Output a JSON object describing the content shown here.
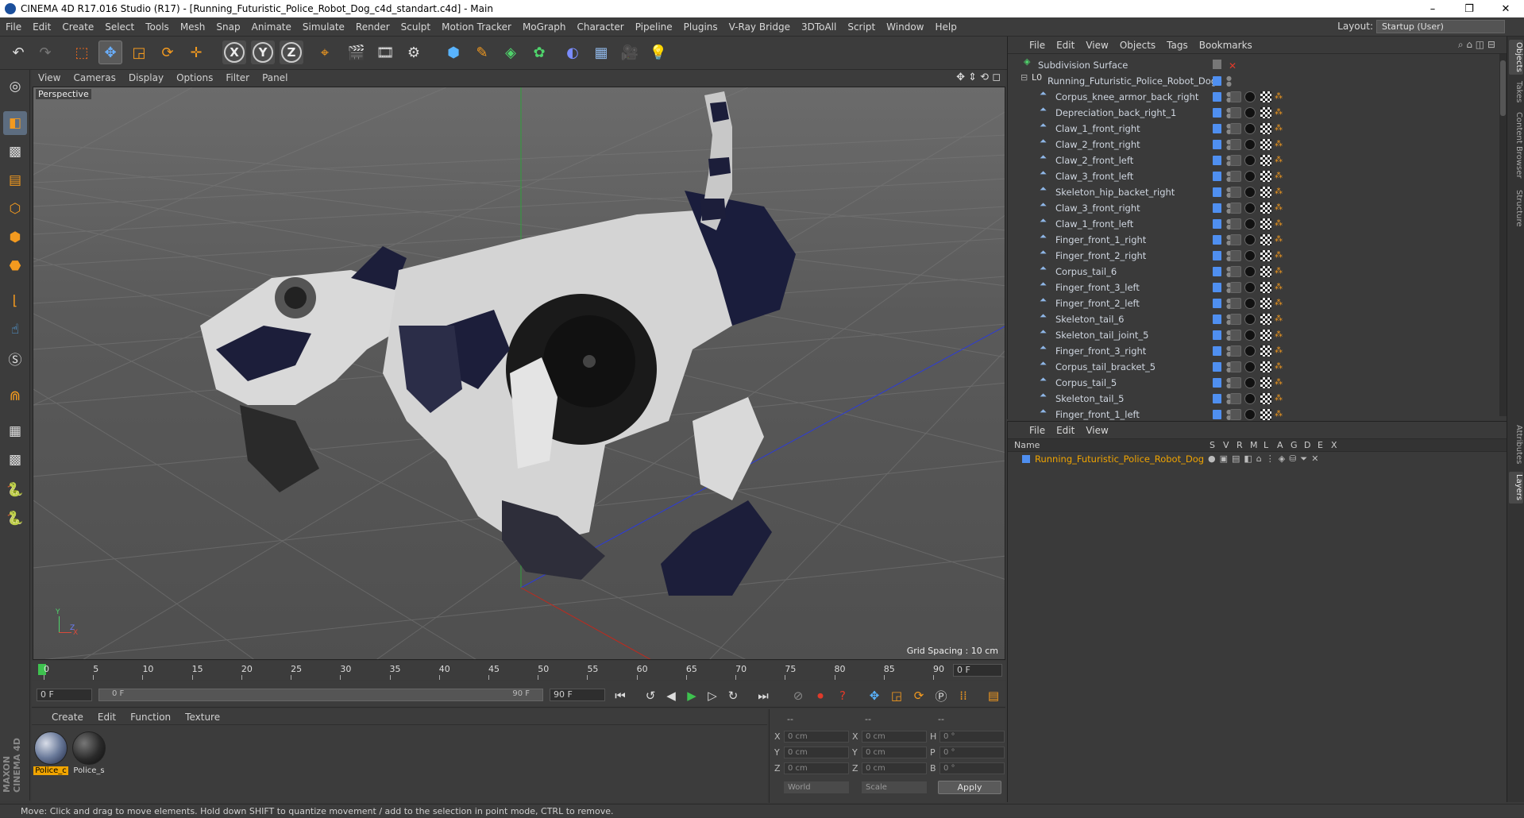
{
  "window": {
    "title": "CINEMA 4D R17.016 Studio (R17) - [Running_Futuristic_Police_Robot_Dog_c4d_standart.c4d] - Main",
    "minimize": "–",
    "maximize": "❐",
    "close": "✕"
  },
  "menubar": {
    "items": [
      "File",
      "Edit",
      "Create",
      "Select",
      "Tools",
      "Mesh",
      "Snap",
      "Animate",
      "Simulate",
      "Render",
      "Sculpt",
      "Motion Tracker",
      "MoGraph",
      "Character",
      "Pipeline",
      "Plugins",
      "V-Ray Bridge",
      "3DToAll",
      "Script",
      "Window",
      "Help"
    ],
    "layout_label": "Layout:",
    "layout_value": "Startup (User)"
  },
  "toolbar": {
    "x_axis": "X",
    "y_axis": "Y",
    "z_axis": "Z"
  },
  "viewport": {
    "menu": [
      "View",
      "Cameras",
      "Display",
      "Options",
      "Filter",
      "Panel"
    ],
    "label": "Perspective",
    "grid_spacing": "Grid Spacing : 10 cm",
    "axis_x": "X",
    "axis_y": "Y",
    "axis_z": "Z"
  },
  "timeline": {
    "ticks": [
      "0",
      "5",
      "10",
      "15",
      "20",
      "25",
      "30",
      "35",
      "40",
      "45",
      "50",
      "55",
      "60",
      "65",
      "70",
      "75",
      "80",
      "85",
      "90"
    ],
    "current_frame": "0 F",
    "start_field": "0 F",
    "slider_start": "0 F",
    "slider_end": "90 F",
    "end_field": "90 F"
  },
  "materials": {
    "menu": [
      "Create",
      "Edit",
      "Function",
      "Texture"
    ],
    "items": [
      {
        "label": "Police_c",
        "selected": true
      },
      {
        "label": "Police_s",
        "selected": false
      }
    ]
  },
  "coordinates": {
    "header": [
      "--",
      "--",
      "--"
    ],
    "rows": [
      {
        "l1": "X",
        "v1": "0 cm",
        "l2": "X",
        "v2": "0 cm",
        "l3": "H",
        "v3": "0 °"
      },
      {
        "l1": "Y",
        "v1": "0 cm",
        "l2": "Y",
        "v2": "0 cm",
        "l3": "P",
        "v3": "0 °"
      },
      {
        "l1": "Z",
        "v1": "0 cm",
        "l2": "Z",
        "v2": "0 cm",
        "l3": "B",
        "v3": "0 °"
      }
    ],
    "world": "World",
    "scale": "Scale",
    "apply": "Apply"
  },
  "object_manager": {
    "menu": [
      "File",
      "Edit",
      "View",
      "Objects",
      "Tags",
      "Bookmarks"
    ],
    "root": "Subdivision Surface",
    "group": "Running_Futuristic_Police_Robot_Dog",
    "objects": [
      "Corpus_knee_armor_back_right",
      "Depreciation_back_right_1",
      "Claw_1_front_right",
      "Claw_2_front_right",
      "Claw_2_front_left",
      "Claw_3_front_left",
      "Skeleton_hip_backet_right",
      "Claw_3_front_right",
      "Claw_1_front_left",
      "Finger_front_1_right",
      "Finger_front_2_right",
      "Corpus_tail_6",
      "Finger_front_3_left",
      "Finger_front_2_left",
      "Skeleton_tail_6",
      "Skeleton_tail_joint_5",
      "Finger_front_3_right",
      "Corpus_tail_bracket_5",
      "Corpus_tail_5",
      "Skeleton_tail_5",
      "Finger_front_1_left"
    ]
  },
  "layer_manager": {
    "menu": [
      "File",
      "Edit",
      "View"
    ],
    "columns": [
      "Name",
      "S",
      "V",
      "R",
      "M",
      "L",
      "A",
      "G",
      "D",
      "E",
      "X"
    ],
    "layer": "Running_Futuristic_Police_Robot_Dog",
    "layer_color": "#f0a400"
  },
  "side_tabs": [
    "Objects",
    "Takes",
    "Content Browser",
    "Structure",
    "Attributes",
    "Layers"
  ],
  "status": "Move: Click and drag to move elements. Hold down SHIFT to quantize movement / add to the selection in point mode, CTRL to remove.",
  "branding": "MAXON CINEMA 4D"
}
